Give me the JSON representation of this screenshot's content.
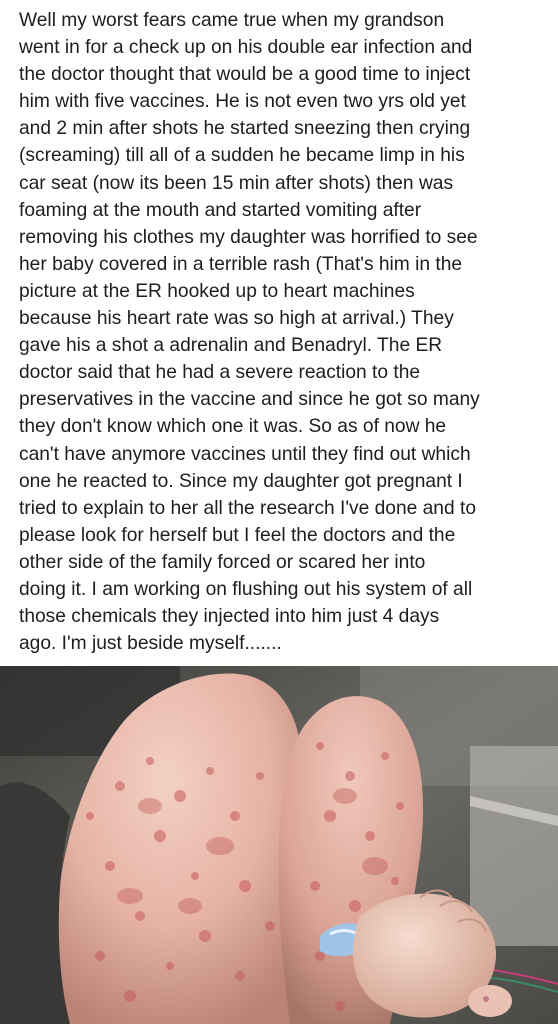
{
  "post": {
    "text": "Well my worst fears came true when my grandson\nwent in for a check up on his double ear infection and\nthe doctor thought that would be a good time to inject\nhim with five vaccines. He is not even two yrs old yet\nand 2 min after shots he started sneezing then crying\n(screaming) till all of a sudden he became limp in his\ncar seat (now its been 15 min after shots) then was\nfoaming at the mouth and started vomiting after\nremoving his clothes my daughter was horrified to see\nher baby covered in a terrible rash (That's him in the\npicture at the ER hooked up to heart machines\nbecause his heart rate was so high at arrival.) They\ngave his a shot a adrenalin and Benadryl. The ER\ndoctor said that he had a severe reaction to the\npreservatives in the vaccine and since he got so many\nthey don't know which one it was. So as of now he\ncan't have anymore vaccines until they find out which\none he reacted to. Since my daughter got pregnant I\ntried to explain to her all the research I've done and to\nplease look for herself but I feel the doctors and the\nother side of the family forced or scared her into\ndoing it. I am working on flushing out his system of all\nthose chemicals they injected into him just 4 days\nago. I'm just beside myself.......",
    "photo_icon": "photo-rash-legs",
    "colors": {
      "text": "#1c1e21",
      "background": "#ffffff",
      "skin": "#e8b8a8",
      "rash": "#c8585a"
    }
  }
}
